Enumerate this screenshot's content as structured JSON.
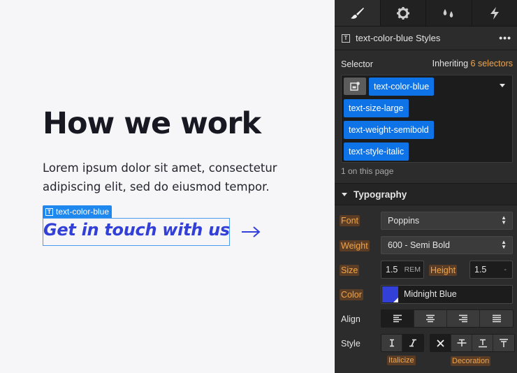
{
  "canvas": {
    "heading": "How we work",
    "body": "Lorem ipsum dolor sit amet, consectetur adipiscing elit, sed do eiusmod tempor.",
    "selection_badge": "text-color-blue",
    "cta_text": "Get in touch with us",
    "accent_color": "#3340d8"
  },
  "panel": {
    "tabs": [
      "paintbrush-icon",
      "gear-icon",
      "drops-icon",
      "lightning-icon"
    ],
    "active_tab": 0,
    "title": "text-color-blue Styles",
    "more_label": "•••",
    "selector": {
      "label": "Selector",
      "inheriting_prefix": "Inheriting",
      "inheriting_count": "6 selectors",
      "chips": [
        "text-color-blue",
        "text-size-large",
        "text-weight-semibold",
        "text-style-italic"
      ],
      "on_page": "1 on this page"
    },
    "typography": {
      "section_title": "Typography",
      "font_label": "Font",
      "font_value": "Poppins",
      "weight_label": "Weight",
      "weight_value": "600 - Semi Bold",
      "size_label": "Size",
      "size_value": "1.5",
      "size_unit": "REM",
      "height_label": "Height",
      "height_value": "1.5",
      "height_unit": "-",
      "color_label": "Color",
      "color_value": "Midnight Blue",
      "color_hex": "#3340d8",
      "align_label": "Align",
      "align_options": [
        "align-left-icon",
        "align-center-icon",
        "align-right-icon",
        "align-justify-icon"
      ],
      "align_active": 0,
      "style_label": "Style",
      "italicize_caption": "Italicize",
      "decoration_caption": "Decoration"
    }
  }
}
